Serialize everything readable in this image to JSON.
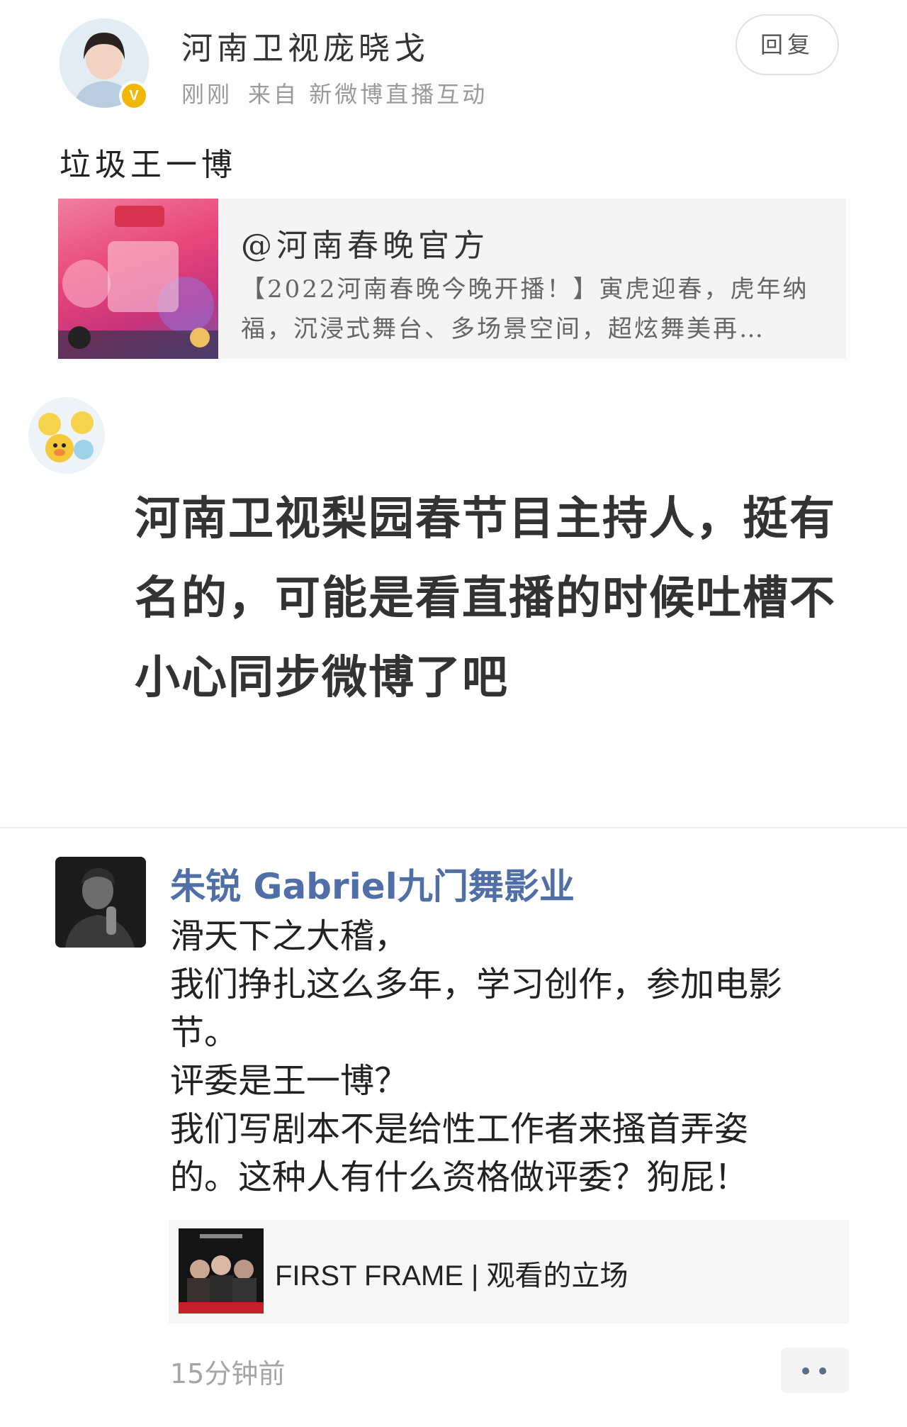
{
  "post": {
    "author": "河南卫视庞晓戈",
    "time": "刚刚",
    "source": "来自 新微博直播互动",
    "reply_label": "回复",
    "text": "垃圾王一博",
    "verified_badge": "V",
    "card": {
      "title": "@河南春晚官方",
      "desc": "【2022河南春晚今晚开播！】寅虎迎春，虎年纳福，沉浸式舞台、多场景空间，超炫舞美再…"
    }
  },
  "comment": {
    "text": "河南卫视梨园春节目主持人，挺有名的，可能是看直播的时候吐槽不小心同步微博了吧"
  },
  "post2": {
    "author": "朱锐 Gabriel九门舞影业",
    "lines": [
      "滑天下之大稽，",
      "我们挣扎这么多年，学习创作，参加电影",
      "节。",
      "评委是王一博？",
      "我们写剧本不是给性工作者来搔首弄姿",
      "的。这种人有什么资格做评委？狗屁！"
    ],
    "link_title": "FIRST FRAME | 观看的立场",
    "time": "15分钟前"
  },
  "icons": {
    "more": "more-dots-icon",
    "verified": "verified-badge-icon"
  },
  "colors": {
    "name_link": "#4f6fa6",
    "verified": "#f2b705"
  }
}
